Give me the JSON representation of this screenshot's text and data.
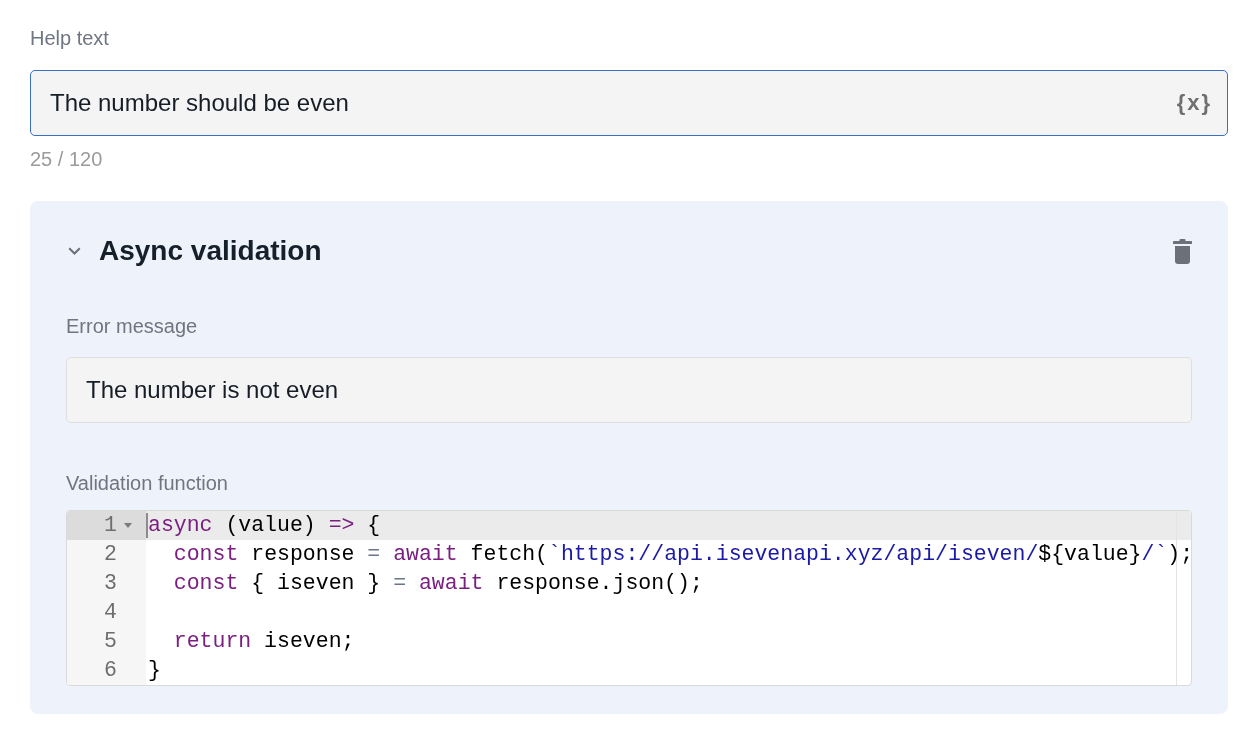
{
  "help_text": {
    "label": "Help text",
    "value": "The number should be even",
    "focused": true,
    "variable_button": "{x}",
    "counter": "25 / 120"
  },
  "async_validation": {
    "title": "Async validation",
    "expanded": true,
    "error_message": {
      "label": "Error message",
      "value": "The number is not even"
    },
    "validation_function": {
      "label": "Validation function",
      "lines": [
        {
          "number": "1",
          "active": true,
          "foldable": true,
          "cursor": true,
          "tokens": [
            {
              "kind": "keyword",
              "text": "async"
            },
            {
              "kind": "plain",
              "text": " (value) "
            },
            {
              "kind": "keyword",
              "text": "=>"
            },
            {
              "kind": "plain",
              "text": " {"
            }
          ]
        },
        {
          "number": "2",
          "active": false,
          "foldable": false,
          "cursor": false,
          "tokens": [
            {
              "kind": "keyword",
              "text": "  const"
            },
            {
              "kind": "plain",
              "text": " response "
            },
            {
              "kind": "operator",
              "text": "="
            },
            {
              "kind": "keyword",
              "text": " await"
            },
            {
              "kind": "plain",
              "text": " fetch("
            },
            {
              "kind": "string",
              "text": "`https://api.isevenapi.xyz/api/iseven/"
            },
            {
              "kind": "plain",
              "text": "${value}"
            },
            {
              "kind": "string",
              "text": "/`"
            },
            {
              "kind": "plain",
              "text": ");"
            }
          ]
        },
        {
          "number": "3",
          "active": false,
          "foldable": false,
          "cursor": false,
          "tokens": [
            {
              "kind": "keyword",
              "text": "  const"
            },
            {
              "kind": "plain",
              "text": " { iseven } "
            },
            {
              "kind": "operator",
              "text": "="
            },
            {
              "kind": "keyword",
              "text": " await"
            },
            {
              "kind": "plain",
              "text": " response.json();"
            }
          ]
        },
        {
          "number": "4",
          "active": false,
          "foldable": false,
          "cursor": false
        },
        {
          "number": "5",
          "active": false,
          "foldable": false,
          "cursor": false,
          "tokens": [
            {
              "kind": "keyword",
              "text": "  return"
            },
            {
              "kind": "plain",
              "text": " iseven;"
            }
          ]
        },
        {
          "number": "6",
          "active": false,
          "foldable": false,
          "cursor": false,
          "tokens": [
            {
              "kind": "plain",
              "text": "}"
            }
          ]
        }
      ]
    }
  }
}
